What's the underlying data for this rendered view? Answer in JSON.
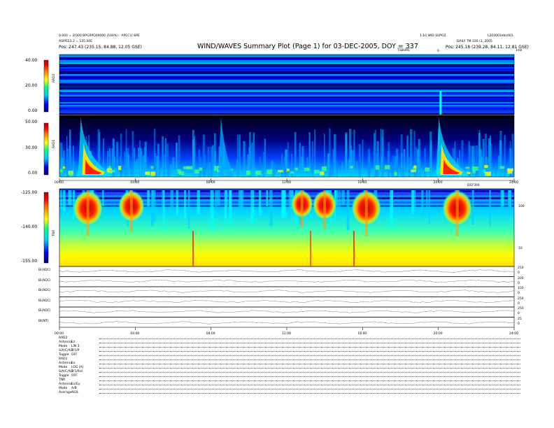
{
  "header": {
    "title": "WIND/WAVES Summary Plot (Page 1) for 03-DEC-2005, DOY = 337",
    "left_line1": "0.000 = 2[000 BPGRPQ00000 (100%) - APEC]{ BPE",
    "left_line2": "ASIPEE3.2 = 135.00E",
    "left_line3": "Pos: 247.43 (235.15, 84.88, 12.05 GSE)",
    "right_line1": "1.10 WID SUPOZ",
    "right_line1b": "L2E0001ebn001",
    "right_line2": "DAILY TM 330 (3, 2005",
    "right_line3": "Pos: 245.18 (239.28, 84.11, 12.81 GSE)",
    "center_right_label": "TSBURE",
    "right_edge_label": "kHz"
  },
  "top_axis": {
    "marker_label": "0"
  },
  "time_axis": {
    "labels": [
      "00:00",
      "04:00",
      "08:00",
      "12:00",
      "16:00",
      "20:00",
      "24:00"
    ],
    "start_hour": 0,
    "end_hour": 24
  },
  "tnr_time_label": "DSY300",
  "rad2": {
    "label": "RAD2",
    "ticks": [
      "40.00",
      "20.00",
      "0.00"
    ],
    "range": [
      0,
      40
    ]
  },
  "rad1": {
    "label": "RAD1",
    "ticks": [
      "50.00",
      "30.00",
      "0.00"
    ],
    "range": [
      0,
      50
    ]
  },
  "tnr": {
    "label": "TNR",
    "ticks": [
      "-125.00",
      "-140.00",
      "-155.00"
    ],
    "range": [
      -155,
      -125
    ],
    "right_ticks": [
      "100",
      "10"
    ]
  },
  "housekeeping": {
    "panels": [
      {
        "label": "Bi(ADC)",
        "right": [
          "250",
          "0"
        ]
      },
      {
        "label": "Bi(ADC)",
        "right": [
          "200",
          "0"
        ]
      },
      {
        "label": "Bi(ADC)",
        "right": [
          "150",
          "0"
        ]
      },
      {
        "label": "Bi(ADC)",
        "right": [
          "250",
          "0"
        ]
      },
      {
        "label": "Bi(ADC)",
        "right": [
          "250",
          "0"
        ]
      },
      {
        "label": "Bt(NT)",
        "right": [
          "25",
          "0"
        ]
      }
    ]
  },
  "footer": {
    "rows": [
      {
        "label": "RAD2",
        "value": ""
      },
      {
        "label": "Antenna",
        "value": "Ez"
      },
      {
        "label": "Mode",
        "value": "LIN 3"
      },
      {
        "label": "S/A/C/A/P",
        "value": "3.5/P"
      },
      {
        "label": "Toggle",
        "value": "OFF"
      },
      {
        "label": "RAD1",
        "value": ""
      },
      {
        "label": "Antenna",
        "value": "Ex"
      },
      {
        "label": "Mode",
        "value": "LOG (A)"
      },
      {
        "label": "S/A/C/A/P",
        "value": "3.5/Rid"
      },
      {
        "label": "Toggle",
        "value": "OFF"
      },
      {
        "label": "TNR",
        "value": ""
      },
      {
        "label": "Antenna",
        "value": "Ex/Ey"
      },
      {
        "label": "Mode",
        "value": "A/B"
      },
      {
        "label": "Average",
        "value": "AGIL"
      }
    ]
  },
  "colors": {
    "colorbar_stops": [
      "#000080",
      "#0000ff",
      "#00c8ff",
      "#00ff80",
      "#ffff00",
      "#ff8000",
      "#ff0000",
      "#b00000"
    ]
  },
  "chart_data": {
    "type": "heatmap",
    "title": "WIND/WAVES Summary Plot (Page 1) for 03-DEC-2005, DOY = 337",
    "x": [
      "00:00",
      "04:00",
      "08:00",
      "12:00",
      "16:00",
      "20:00",
      "24:00"
    ],
    "panels": [
      {
        "name": "RAD2",
        "yticks": [
          "40.00",
          "20.00",
          "0.00"
        ],
        "ylim": [
          0,
          40
        ]
      },
      {
        "name": "RAD1",
        "yticks": [
          "50.00",
          "30.00",
          "0.00"
        ],
        "ylim": [
          0,
          50
        ]
      },
      {
        "name": "TNR",
        "yticks": [
          "-125.00",
          "-140.00",
          "-155.00"
        ],
        "ylim": [
          -155,
          -125
        ]
      }
    ],
    "bursts": [
      {
        "panel": "RAD1",
        "time_hours": 1.2,
        "strength": 1.0
      },
      {
        "panel": "RAD1",
        "time_hours": 8.6,
        "strength": 0.4
      },
      {
        "panel": "RAD1",
        "time_hours": 20.1,
        "strength": 1.0
      },
      {
        "panel": "TNR",
        "time_hours": 1.5,
        "strength": 1.0
      },
      {
        "panel": "TNR",
        "time_hours": 3.8,
        "strength": 0.8
      },
      {
        "panel": "TNR",
        "time_hours": 12.8,
        "strength": 0.6
      },
      {
        "panel": "TNR",
        "time_hours": 14.0,
        "strength": 0.7
      },
      {
        "panel": "TNR",
        "time_hours": 16.2,
        "strength": 1.0
      },
      {
        "panel": "TNR",
        "time_hours": 21.0,
        "strength": 1.0
      }
    ]
  }
}
